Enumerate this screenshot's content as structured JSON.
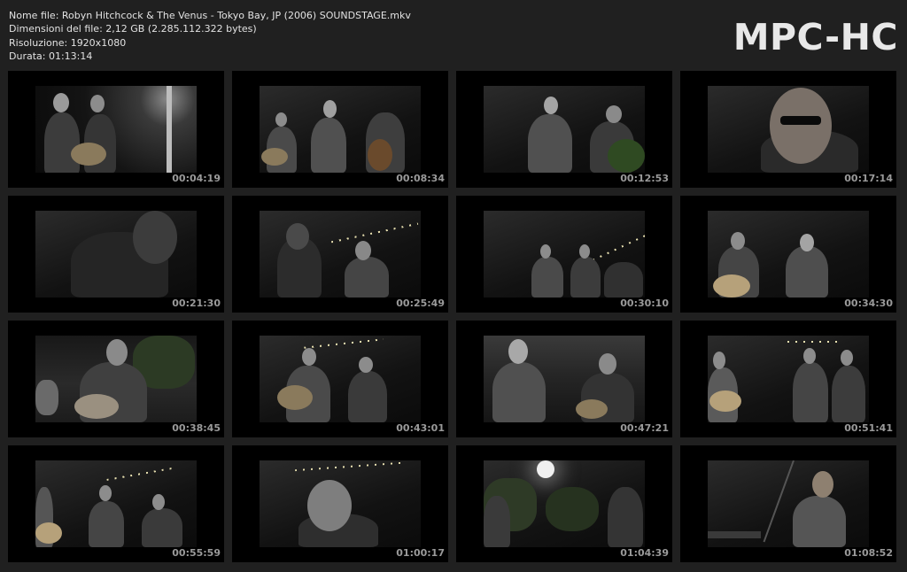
{
  "info": {
    "filename": "Nome file: Robyn Hitchcock & The Venus - Tokyo Bay, JP (2006) SOUNDSTAGE.mkv",
    "filesize": "Dimensioni del file: 2,12 GB (2.285.112.322 bytes)",
    "resolution": "Risoluzione: 1920x1080",
    "duration": "Durata: 01:13:14"
  },
  "brand": "MPC-HC",
  "thumbnails": [
    {
      "time": "00:04:19"
    },
    {
      "time": "00:08:34"
    },
    {
      "time": "00:12:53"
    },
    {
      "time": "00:17:14"
    },
    {
      "time": "00:21:30"
    },
    {
      "time": "00:25:49"
    },
    {
      "time": "00:30:10"
    },
    {
      "time": "00:34:30"
    },
    {
      "time": "00:38:45"
    },
    {
      "time": "00:43:01"
    },
    {
      "time": "00:47:21"
    },
    {
      "time": "00:51:41"
    },
    {
      "time": "00:55:59"
    },
    {
      "time": "01:00:17"
    },
    {
      "time": "01:04:39"
    },
    {
      "time": "01:08:52"
    }
  ]
}
